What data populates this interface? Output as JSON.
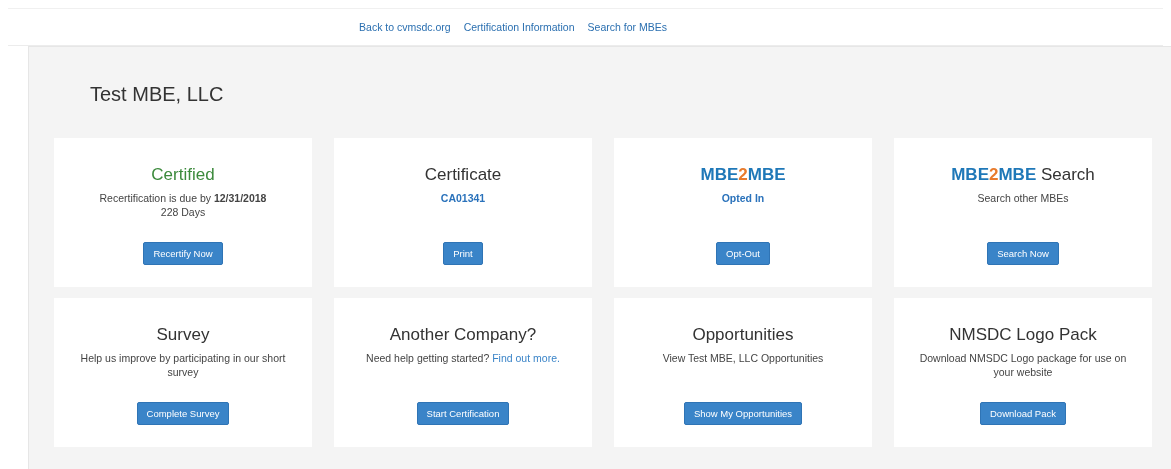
{
  "nav": {
    "links": [
      "Back to cvmsdc.org",
      "Certification Information",
      "Search for MBEs"
    ]
  },
  "page": {
    "title": "Test MBE, LLC"
  },
  "cards": [
    {
      "title": [
        {
          "text": "Certified",
          "kind": "success"
        }
      ],
      "lines": [
        {
          "text": "Recertification is due by **12/31/2018**",
          "kind": "plain"
        },
        {
          "text": "228 Days",
          "kind": "plain"
        }
      ],
      "button": "Recertify Now"
    },
    {
      "title": [
        {
          "text": "Certificate",
          "kind": "plain"
        }
      ],
      "lines": [
        {
          "text": "CA01341",
          "kind": "status"
        }
      ],
      "button": "Print"
    },
    {
      "title": [
        {
          "text": "MBE",
          "kind": "brand"
        },
        {
          "text": "2",
          "kind": "accent"
        },
        {
          "text": "MBE",
          "kind": "brand"
        }
      ],
      "lines": [
        {
          "text": "Opted In",
          "kind": "status"
        }
      ],
      "button": "Opt-Out"
    },
    {
      "title": [
        {
          "text": "MBE",
          "kind": "brand"
        },
        {
          "text": "2",
          "kind": "accent"
        },
        {
          "text": "MBE",
          "kind": "brand"
        },
        {
          "text": " Search",
          "kind": "plain"
        }
      ],
      "lines": [
        {
          "text": "Search other MBEs",
          "kind": "plain"
        }
      ],
      "button": "Search Now"
    },
    {
      "title": [
        {
          "text": "Survey",
          "kind": "plain"
        }
      ],
      "lines": [
        {
          "text": "Help us improve by participating in our short survey",
          "kind": "plain"
        }
      ],
      "button": "Complete Survey"
    },
    {
      "title": [
        {
          "text": "Another Company?",
          "kind": "plain"
        }
      ],
      "lines": [
        {
          "text": "Need help getting started?",
          "kind": "plain",
          "link": "Find out more."
        }
      ],
      "button": "Start Certification"
    },
    {
      "title": [
        {
          "text": "Opportunities",
          "kind": "plain"
        }
      ],
      "lines": [
        {
          "text": "View Test MBE, LLC Opportunities",
          "kind": "plain"
        }
      ],
      "button": "Show My Opportunities"
    },
    {
      "title": [
        {
          "text": "NMSDC Logo Pack",
          "kind": "plain"
        }
      ],
      "lines": [
        {
          "text": "Download NMSDC Logo package for use on your website",
          "kind": "plain"
        }
      ],
      "button": "Download Pack"
    }
  ]
}
